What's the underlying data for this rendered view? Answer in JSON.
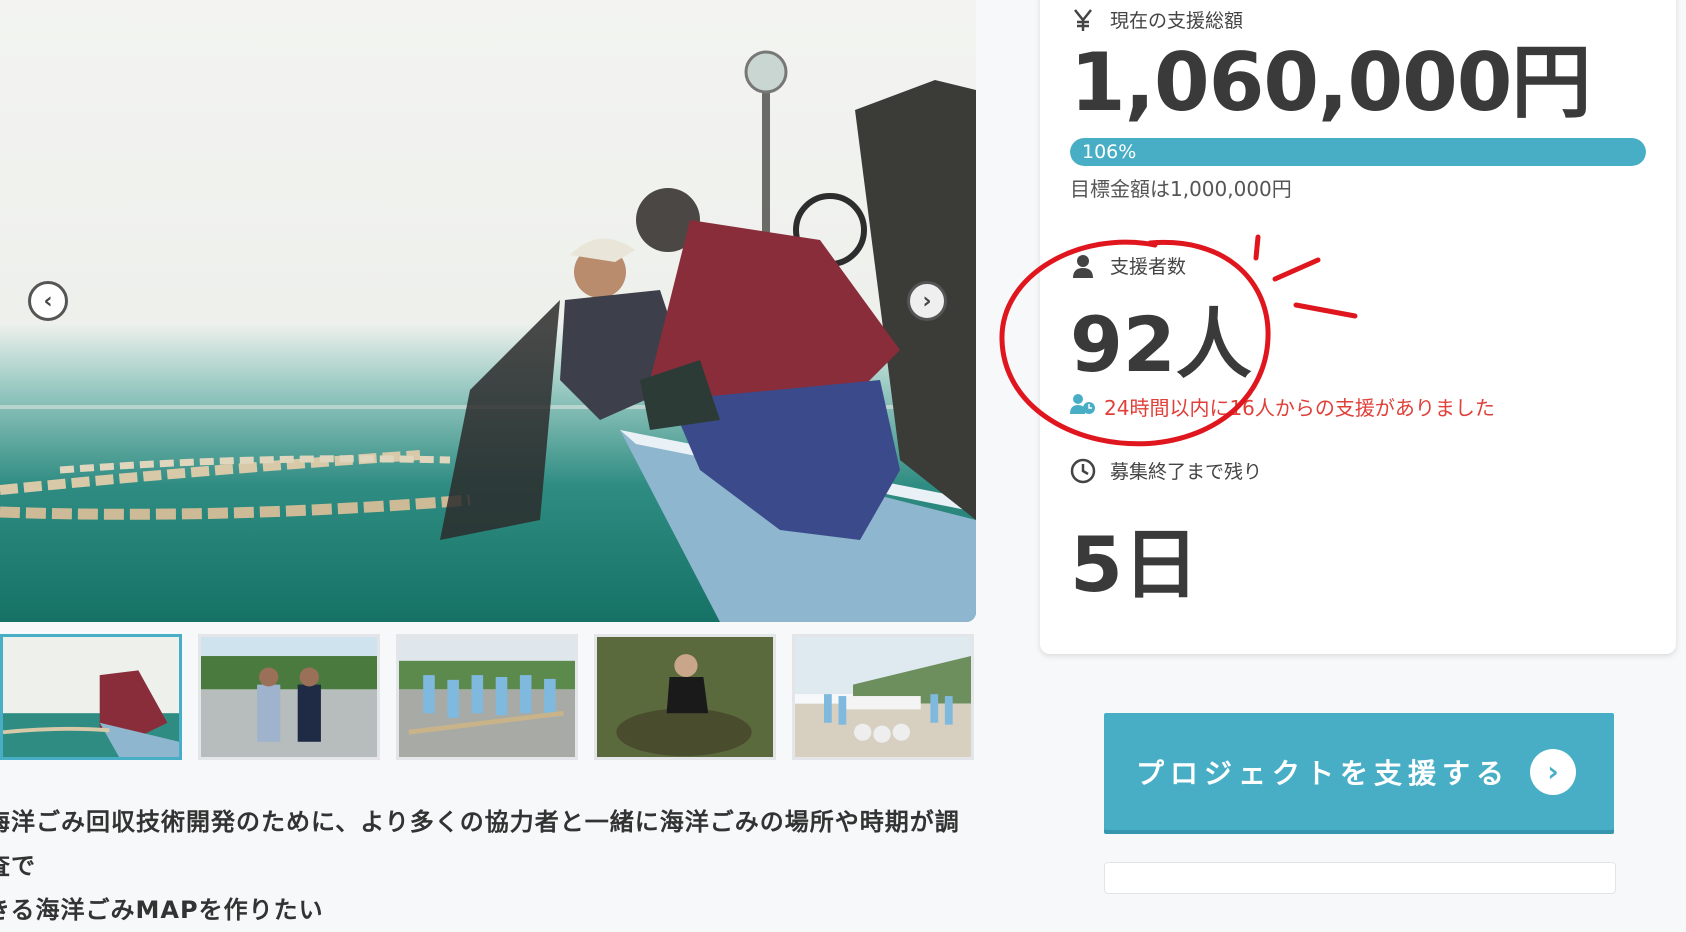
{
  "gallery": {
    "prev_label": "‹",
    "next_label": "›",
    "thumbnail_count": 5,
    "active_index": 0
  },
  "project": {
    "title_line1": "海洋ごみ回収技術開発のために、より多くの協力者と一緒に海洋ごみの場所や時期が調査で",
    "title_line2": "きる海洋ごみMAPを作りたい"
  },
  "stats": {
    "total_label": "現在の支援総額",
    "total_amount": "1,060,000円",
    "progress_text": "106%",
    "progress_value": 1.06,
    "goal_text": "目標金額は1,000,000円",
    "supporters_label": "支援者数",
    "supporters_count": "92人",
    "recent_support_text": "24時間以内に16人からの支援がありました",
    "remaining_label": "募集終了まで残り",
    "remaining_days": "5日"
  },
  "cta": {
    "support_label": "プロジェクトを支援する"
  },
  "colors": {
    "accent": "#48aec6",
    "alert": "#e0403a",
    "annotation": "#e0161e"
  }
}
